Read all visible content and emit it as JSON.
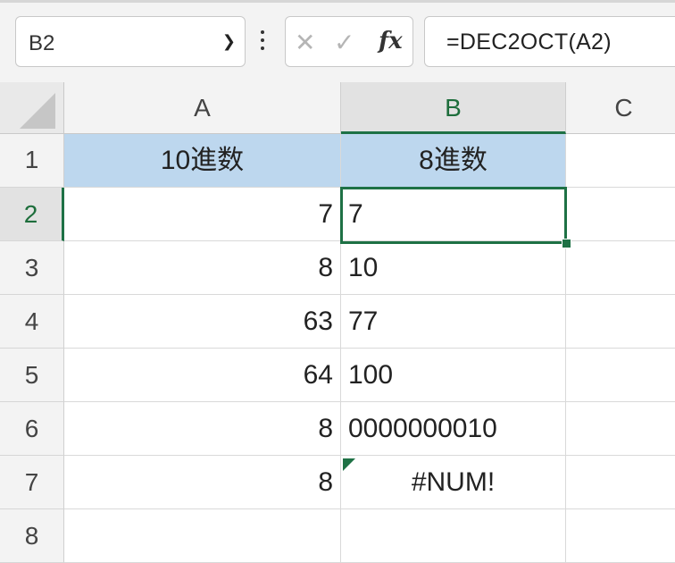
{
  "formula_bar": {
    "name_box": "B2",
    "formula": "=DEC2OCT(A2)",
    "fx_label": "fx"
  },
  "icons": {
    "dropdown": "chevron-down-icon",
    "more": "more-vertical-icon",
    "cancel": "close-icon",
    "enter": "check-icon"
  },
  "columns": [
    "A",
    "B",
    "C"
  ],
  "rows": [
    "1",
    "2",
    "3",
    "4",
    "5",
    "6",
    "7",
    "8"
  ],
  "cells": {
    "A1": "10進数",
    "B1": "8進数",
    "A2": "7",
    "B2": "7",
    "A3": "8",
    "B3": "10",
    "A4": "63",
    "B4": "77",
    "A5": "64",
    "B5": "100",
    "A6": "8",
    "B6": "0000000010",
    "A7": "8",
    "B7": "#NUM!"
  },
  "colors": {
    "header_fill": "#bdd7ee",
    "selection": "#1e7145"
  }
}
